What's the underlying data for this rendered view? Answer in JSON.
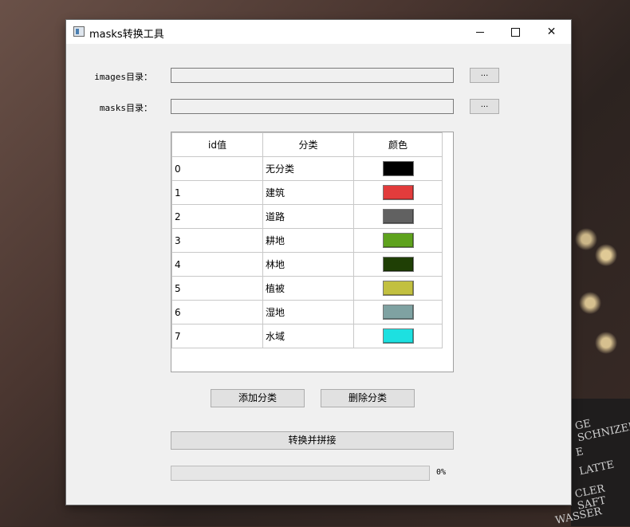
{
  "window": {
    "title": "masks转换工具"
  },
  "images_row": {
    "label": "images目录：",
    "value": "",
    "browse_label": "..."
  },
  "masks_row": {
    "label": "masks目录：",
    "value": "",
    "browse_label": "..."
  },
  "table": {
    "headers": [
      "id值",
      "分类",
      "颜色"
    ],
    "rows": [
      {
        "id": "0",
        "category": "无分类",
        "color": "#000000"
      },
      {
        "id": "1",
        "category": "建筑",
        "color": "#e23c3c"
      },
      {
        "id": "2",
        "category": "道路",
        "color": "#616161"
      },
      {
        "id": "3",
        "category": "耕地",
        "color": "#5ea21d"
      },
      {
        "id": "4",
        "category": "林地",
        "color": "#1f3f05"
      },
      {
        "id": "5",
        "category": "植被",
        "color": "#c2c040"
      },
      {
        "id": "6",
        "category": "湿地",
        "color": "#7fa2a2"
      },
      {
        "id": "7",
        "category": "水域",
        "color": "#1de0e0"
      }
    ]
  },
  "buttons": {
    "add": "添加分类",
    "delete": "删除分类",
    "convert": "转换并拼接"
  },
  "progress": {
    "value": 0,
    "text": "0%"
  },
  "background_sign": [
    "GE SCHNIZEL",
    "E",
    "LATTE",
    "CLER SAFT",
    "WASSER"
  ]
}
